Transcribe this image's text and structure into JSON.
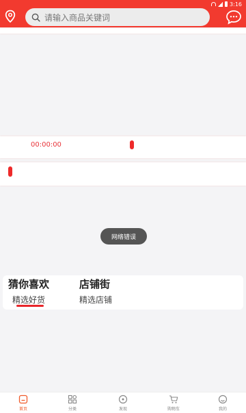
{
  "status_bar": {
    "time": "3:16"
  },
  "header": {
    "search_placeholder": "请输入商品关键词",
    "icons": [
      "location-icon",
      "message-icon"
    ],
    "accent": "#f23a2f"
  },
  "content": {
    "countdown": "00:00:00",
    "toast": "网络错误"
  },
  "tabs": [
    {
      "title": "猜你喜欢",
      "subtitle": "精选好货",
      "active": true
    },
    {
      "title": "店铺街",
      "subtitle": "精选店铺",
      "active": false
    }
  ],
  "bottom_nav": [
    {
      "label": "首页",
      "icon": "home-icon",
      "active": true
    },
    {
      "label": "分类",
      "icon": "grid-icon",
      "active": false
    },
    {
      "label": "发现",
      "icon": "discover-icon",
      "active": false
    },
    {
      "label": "购物车",
      "icon": "cart-icon",
      "active": false
    },
    {
      "label": "我的",
      "icon": "profile-icon",
      "active": false
    }
  ]
}
